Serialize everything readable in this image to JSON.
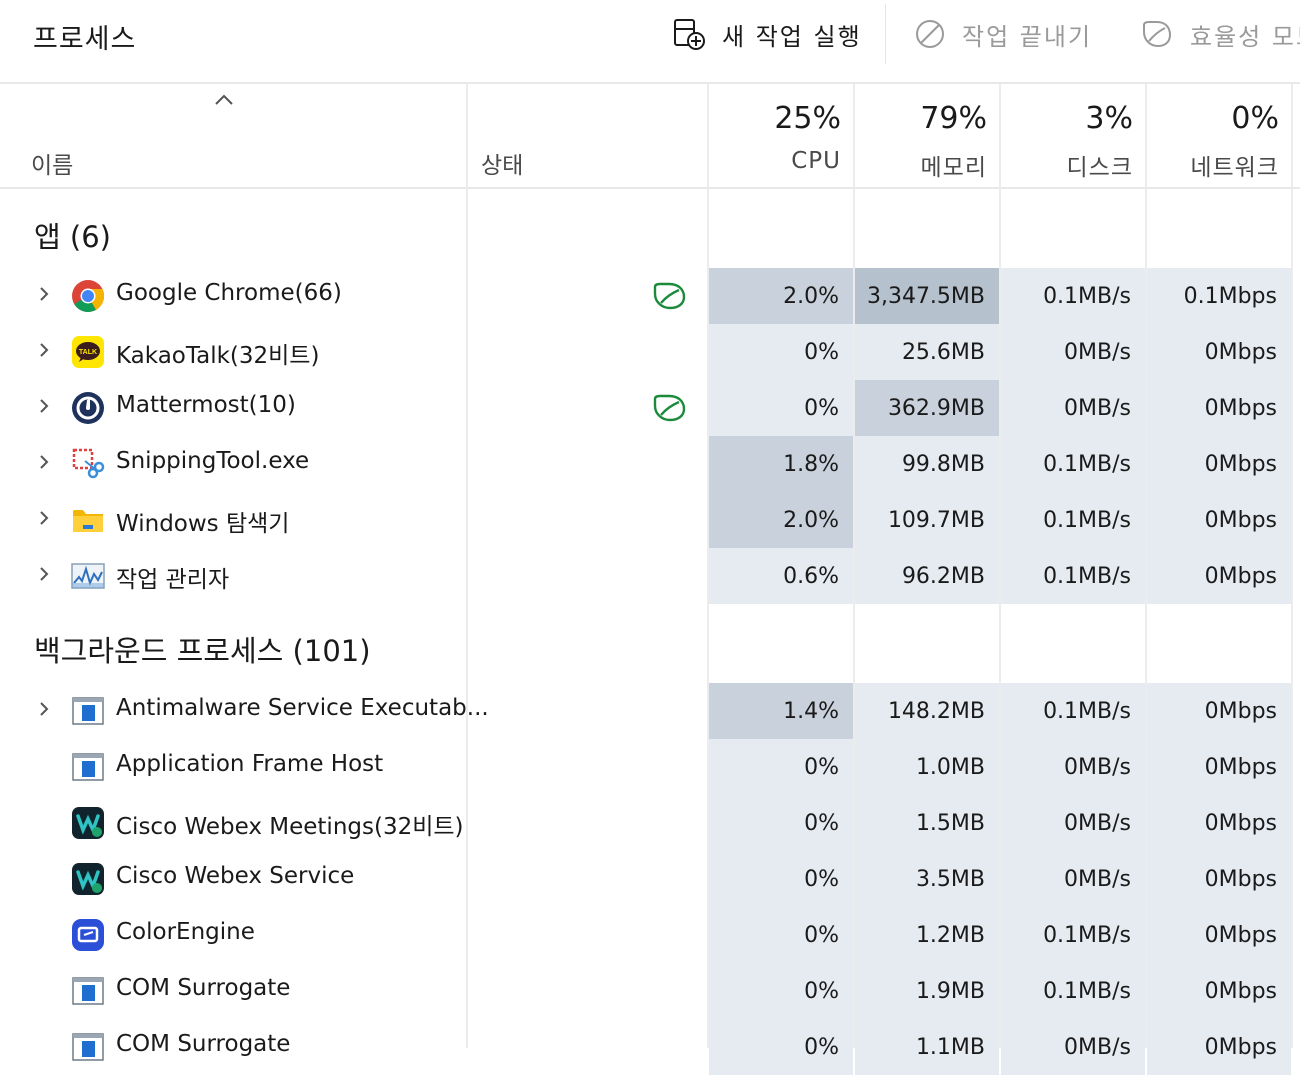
{
  "toolbar": {
    "title": "프로세스",
    "run_task_label": "새 작업 실행",
    "end_task_label": "작업 끝내기",
    "efficiency_label": "효율성 모드"
  },
  "columns": {
    "name": "이름",
    "status": "상태",
    "cpu": {
      "pct": "25%",
      "label": "CPU"
    },
    "memory": {
      "pct": "79%",
      "label": "메모리"
    },
    "disk": {
      "pct": "3%",
      "label": "디스크"
    },
    "network": {
      "pct": "0%",
      "label": "네트워크"
    }
  },
  "groups": {
    "apps": "앱 (6)",
    "background": "백그라운드 프로세스 (101)"
  },
  "rows": [
    {
      "name": "Google Chrome(66)",
      "cpu": "2.0%",
      "mem": "3,347.5MB",
      "disk": "0.1MB/s",
      "net": "0.1Mbps",
      "icon": "chrome-icon",
      "efficiency": true
    },
    {
      "name": "KakaoTalk(32비트)",
      "cpu": "0%",
      "mem": "25.6MB",
      "disk": "0MB/s",
      "net": "0Mbps",
      "icon": "kakaotalk-icon",
      "efficiency": false
    },
    {
      "name": "Mattermost(10)",
      "cpu": "0%",
      "mem": "362.9MB",
      "disk": "0MB/s",
      "net": "0Mbps",
      "icon": "mattermost-icon",
      "efficiency": true
    },
    {
      "name": "SnippingTool.exe",
      "cpu": "1.8%",
      "mem": "99.8MB",
      "disk": "0.1MB/s",
      "net": "0Mbps",
      "icon": "snipping-tool-icon",
      "efficiency": false
    },
    {
      "name": "Windows 탐색기",
      "cpu": "2.0%",
      "mem": "109.7MB",
      "disk": "0.1MB/s",
      "net": "0Mbps",
      "icon": "folder-icon",
      "efficiency": false
    },
    {
      "name": "작업 관리자",
      "cpu": "0.6%",
      "mem": "96.2MB",
      "disk": "0.1MB/s",
      "net": "0Mbps",
      "icon": "task-manager-icon",
      "efficiency": false
    },
    {
      "name": "Antimalware Service Executab...",
      "cpu": "1.4%",
      "mem": "148.2MB",
      "disk": "0.1MB/s",
      "net": "0Mbps",
      "icon": "window-app-icon",
      "efficiency": false
    },
    {
      "name": "Application Frame Host",
      "cpu": "0%",
      "mem": "1.0MB",
      "disk": "0MB/s",
      "net": "0Mbps",
      "icon": "window-app-icon",
      "efficiency": false
    },
    {
      "name": "Cisco Webex Meetings(32비트)",
      "cpu": "0%",
      "mem": "1.5MB",
      "disk": "0MB/s",
      "net": "0Mbps",
      "icon": "webex-icon",
      "efficiency": false
    },
    {
      "name": "Cisco Webex Service",
      "cpu": "0%",
      "mem": "3.5MB",
      "disk": "0MB/s",
      "net": "0Mbps",
      "icon": "webex-icon",
      "efficiency": false
    },
    {
      "name": "ColorEngine",
      "cpu": "0%",
      "mem": "1.2MB",
      "disk": "0.1MB/s",
      "net": "0Mbps",
      "icon": "color-engine-icon",
      "efficiency": false
    },
    {
      "name": "COM Surrogate",
      "cpu": "0%",
      "mem": "1.9MB",
      "disk": "0.1MB/s",
      "net": "0Mbps",
      "icon": "window-app-icon",
      "efficiency": false
    },
    {
      "name": "COM Surrogate",
      "cpu": "0%",
      "mem": "1.1MB",
      "disk": "0MB/s",
      "net": "0Mbps",
      "icon": "window-app-icon",
      "efficiency": false
    }
  ]
}
